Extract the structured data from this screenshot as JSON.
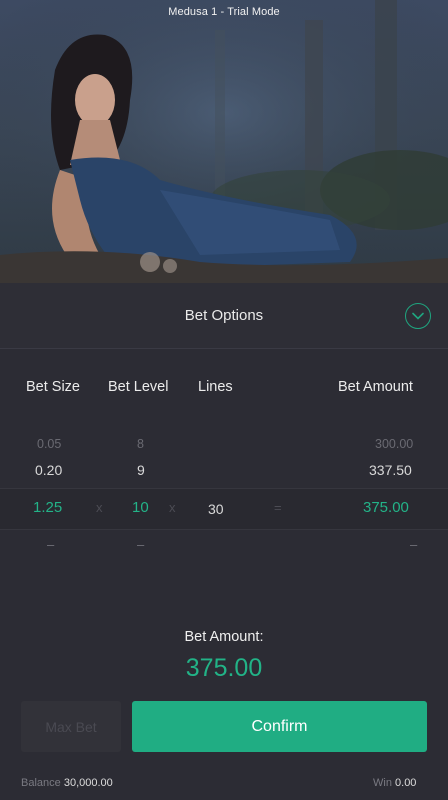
{
  "game": {
    "title": "Medusa 1 - Trial Mode"
  },
  "panel": {
    "title": "Bet Options"
  },
  "columns": {
    "bet_size": "Bet Size",
    "bet_level": "Bet Level",
    "lines": "Lines",
    "bet_amount": "Bet Amount"
  },
  "wheels": {
    "bet_size": {
      "above2": "0.05",
      "above1": "0.20",
      "selected": "1.25",
      "below1": "–"
    },
    "bet_level": {
      "above2": "8",
      "above1": "9",
      "selected": "10",
      "below1": "–"
    },
    "lines": {
      "selected": "30"
    },
    "bet_amount": {
      "above2": "300.00",
      "above1": "337.50",
      "selected": "375.00",
      "below1": "–"
    },
    "operators": {
      "times": "x",
      "equals": "="
    }
  },
  "summary": {
    "label": "Bet Amount:",
    "value": "375.00"
  },
  "buttons": {
    "max_bet": "Max Bet",
    "confirm": "Confirm"
  },
  "footer": {
    "balance_label": "Balance",
    "balance_value": "30,000.00",
    "win_label": "Win",
    "win_value": "0.00"
  },
  "colors": {
    "accent": "#22b387",
    "background": "#2c2c34"
  },
  "icons": {
    "collapse": "chevron-down-icon"
  }
}
